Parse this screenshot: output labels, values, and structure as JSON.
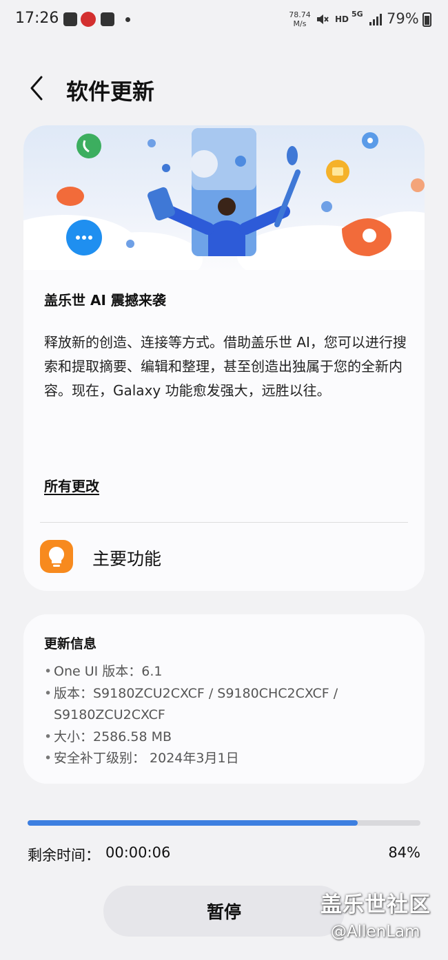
{
  "status_bar": {
    "time": "17:26",
    "speed_value": "78.74",
    "speed_unit": "M/s",
    "hd": "HD",
    "network": "5G",
    "battery": "79%"
  },
  "header": {
    "title": "软件更新"
  },
  "feature": {
    "title": "盖乐世 AI 震撼来袭",
    "description": "释放新的创造、连接等方式。借助盖乐世 AI，您可以进行搜索和提取摘要、编辑和整理，甚至创造出独属于您的全新内容。现在，Galaxy 功能愈发强大，远胜以往。",
    "all_changes": "所有更改",
    "key_features": "主要功能"
  },
  "update_info": {
    "title": "更新信息",
    "items": [
      "One UI 版本：6.1",
      "版本：S9180ZCU2CXCF / S9180CHC2CXCF / S9180ZCU2CXCF",
      "大小：2586.58 MB",
      "安全补丁级别： 2024年3月1日"
    ]
  },
  "progress": {
    "remaining_label": "剩余时间：",
    "remaining_value": "00:00:06",
    "percent_label": "84%",
    "percent_value": 0.84
  },
  "pause_label": "暂停",
  "watermark": {
    "line1": "盖乐世社区",
    "line2": "@AllenLam"
  },
  "colors": {
    "accent": "#3d7fe0",
    "key_feature_icon": "#f78a1e",
    "card_bg": "#fbfbfd",
    "page_bg": "#f2f2f4"
  }
}
